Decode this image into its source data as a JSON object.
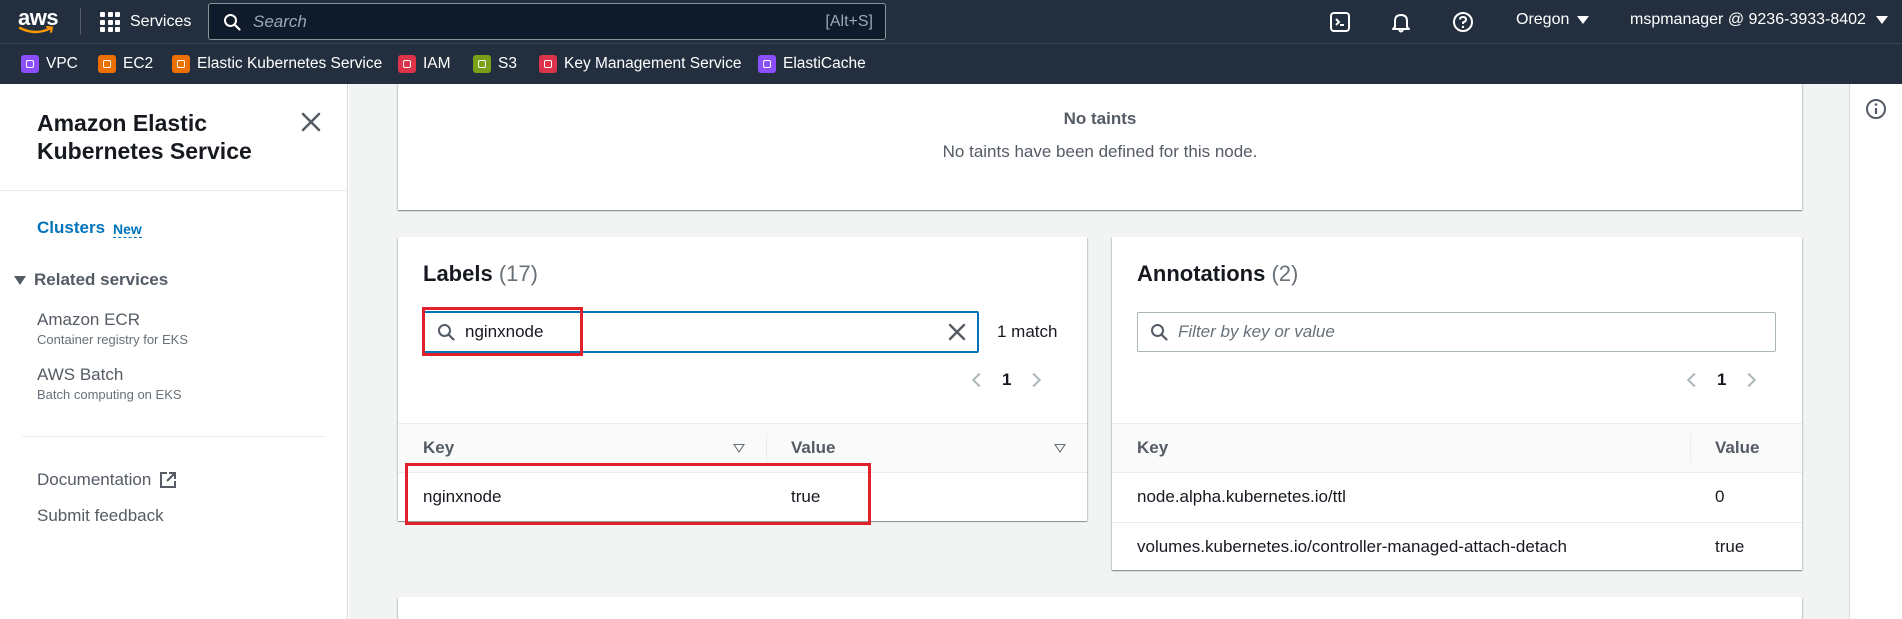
{
  "topnav": {
    "logo_text": "aws",
    "services_label": "Services",
    "search_placeholder": "Search",
    "search_shortcut": "[Alt+S]",
    "region": "Oregon",
    "account": "mspmanager @ 9236-3933-8402"
  },
  "favorites": [
    {
      "label": "VPC",
      "color": "#8c4fff"
    },
    {
      "label": "EC2",
      "color": "#ed7100"
    },
    {
      "label": "Elastic Kubernetes Service",
      "color": "#ed7100"
    },
    {
      "label": "IAM",
      "color": "#dd344c"
    },
    {
      "label": "S3",
      "color": "#7aa116"
    },
    {
      "label": "Key Management Service",
      "color": "#dd344c"
    },
    {
      "label": "ElastiCache",
      "color": "#8c4fff"
    }
  ],
  "sidebar": {
    "title": "Amazon Elastic Kubernetes Service",
    "clusters": "Clusters",
    "new_badge": "New",
    "related_services": "Related services",
    "ecr": {
      "label": "Amazon ECR",
      "sub": "Container registry for EKS"
    },
    "batch": {
      "label": "AWS Batch",
      "sub": "Batch computing on EKS"
    },
    "documentation": "Documentation",
    "feedback": "Submit feedback"
  },
  "taints": {
    "title": "No taints",
    "description": "No taints have been defined for this node."
  },
  "labels": {
    "title": "Labels",
    "count": "(17)",
    "filter_value": "nginxnode",
    "match_text": "1 match",
    "page": "1",
    "columns": [
      "Key",
      "Value"
    ],
    "rows": [
      {
        "key": "nginxnode",
        "value": "true"
      }
    ]
  },
  "annotations": {
    "title": "Annotations",
    "count": "(2)",
    "filter_placeholder": "Filter by key or value",
    "page": "1",
    "columns": [
      "Key",
      "Value"
    ],
    "rows": [
      {
        "key": "node.alpha.kubernetes.io/ttl",
        "value": "0"
      },
      {
        "key": "volumes.kubernetes.io/controller-managed-attach-detach",
        "value": "true"
      }
    ]
  },
  "colors": {
    "nav_bg": "#232f3e",
    "link": "#0073bb",
    "highlight": "#e0202a",
    "page_bg": "#f2f3f3"
  }
}
